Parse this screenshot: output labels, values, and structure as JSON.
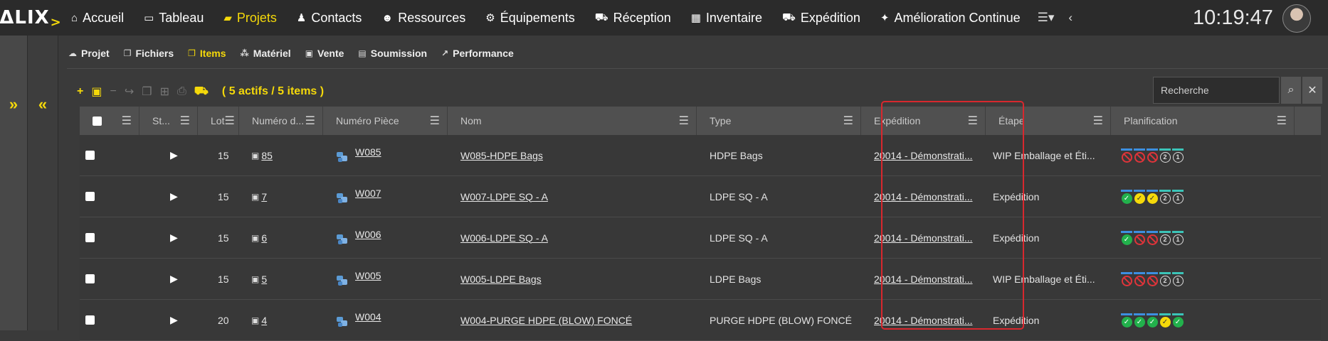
{
  "logo": "ΔLIX",
  "nav": [
    {
      "label": "Accueil",
      "icon": "home-icon",
      "glyph": "⌂"
    },
    {
      "label": "Tableau",
      "icon": "monitor-icon",
      "glyph": "▭"
    },
    {
      "label": "Projets",
      "icon": "folder-icon",
      "glyph": "▰",
      "active": true
    },
    {
      "label": "Contacts",
      "icon": "person-icon",
      "glyph": "♟"
    },
    {
      "label": "Ressources",
      "icon": "users-icon",
      "glyph": "☻"
    },
    {
      "label": "Équipements",
      "icon": "gears-icon",
      "glyph": "⚙"
    },
    {
      "label": "Réception",
      "icon": "truck-icon",
      "glyph": "⛟"
    },
    {
      "label": "Inventaire",
      "icon": "grid-icon",
      "glyph": "▦"
    },
    {
      "label": "Expédition",
      "icon": "truck-icon",
      "glyph": "⛟"
    },
    {
      "label": "Amélioration Continue",
      "icon": "magic-icon",
      "glyph": "✦"
    }
  ],
  "clock": "10:19:47",
  "subtabs": [
    {
      "label": "Projet",
      "icon": "cloud-icon",
      "glyph": "☁"
    },
    {
      "label": "Fichiers",
      "icon": "copy-icon",
      "glyph": "❐"
    },
    {
      "label": "Items",
      "icon": "copy-icon",
      "glyph": "❐",
      "active": true
    },
    {
      "label": "Matériel",
      "icon": "cubes-icon",
      "glyph": "⁂"
    },
    {
      "label": "Vente",
      "icon": "money-icon",
      "glyph": "▣"
    },
    {
      "label": "Soumission",
      "icon": "file-icon",
      "glyph": "▤"
    },
    {
      "label": "Performance",
      "icon": "chart-icon",
      "glyph": "↗"
    }
  ],
  "toolbar": {
    "count": "( 5 actifs / 5 items )"
  },
  "search": {
    "placeholder": "Recherche"
  },
  "columns": [
    {
      "label": "",
      "width": 84
    },
    {
      "label": "St...",
      "width": 82
    },
    {
      "label": "Lot",
      "width": 58
    },
    {
      "label": "Numéro d...",
      "width": 118
    },
    {
      "label": "Numéro Pièce",
      "width": 175
    },
    {
      "label": "Nom",
      "width": 350
    },
    {
      "label": "Type",
      "width": 231
    },
    {
      "label": "Expédition",
      "width": 175
    },
    {
      "label": "Étape",
      "width": 176
    },
    {
      "label": "Planification",
      "width": 258
    }
  ],
  "rows": [
    {
      "lot": "15",
      "numero": "85",
      "piece": "W085",
      "nom": "W085-HDPE Bags",
      "type": "HDPE Bags",
      "expedition": "20014 - Démonstrati...",
      "etape": "WIP Emballage et Éti...",
      "plan": [
        "no",
        "no",
        "no",
        "2",
        "1"
      ]
    },
    {
      "lot": "15",
      "numero": "7",
      "piece": "W007",
      "nom": "W007-LDPE SQ - A",
      "type": "LDPE SQ - A",
      "expedition": "20014 - Démonstrati...",
      "etape": "Expédition",
      "plan": [
        "ok",
        "warn",
        "warn",
        "2",
        "1"
      ]
    },
    {
      "lot": "15",
      "numero": "6",
      "piece": "W006",
      "nom": "W006-LDPE SQ - A",
      "type": "LDPE SQ - A",
      "expedition": "20014 - Démonstrati...",
      "etape": "Expédition",
      "plan": [
        "ok",
        "no",
        "no",
        "2",
        "1"
      ]
    },
    {
      "lot": "15",
      "numero": "5",
      "piece": "W005",
      "nom": "W005-LDPE Bags",
      "type": "LDPE Bags",
      "expedition": "20014 - Démonstrati...",
      "etape": "WIP Emballage et Éti...",
      "plan": [
        "no",
        "no",
        "no",
        "2",
        "1"
      ]
    },
    {
      "lot": "20",
      "numero": "4",
      "piece": "W004",
      "nom": "W004-PURGE HDPE (BLOW) FONCÉ",
      "type": "PURGE HDPE (BLOW) FONCÉ",
      "expedition": "20014 - Démonstrati...",
      "etape": "Expédition",
      "plan": [
        "ok",
        "ok",
        "ok",
        "warn",
        "ok"
      ]
    }
  ],
  "colors": {
    "accent": "#f5d90a",
    "bar_blue": "#3d8fe0",
    "bar_teal": "#3bc4b8",
    "highlight": "#d8282e"
  }
}
